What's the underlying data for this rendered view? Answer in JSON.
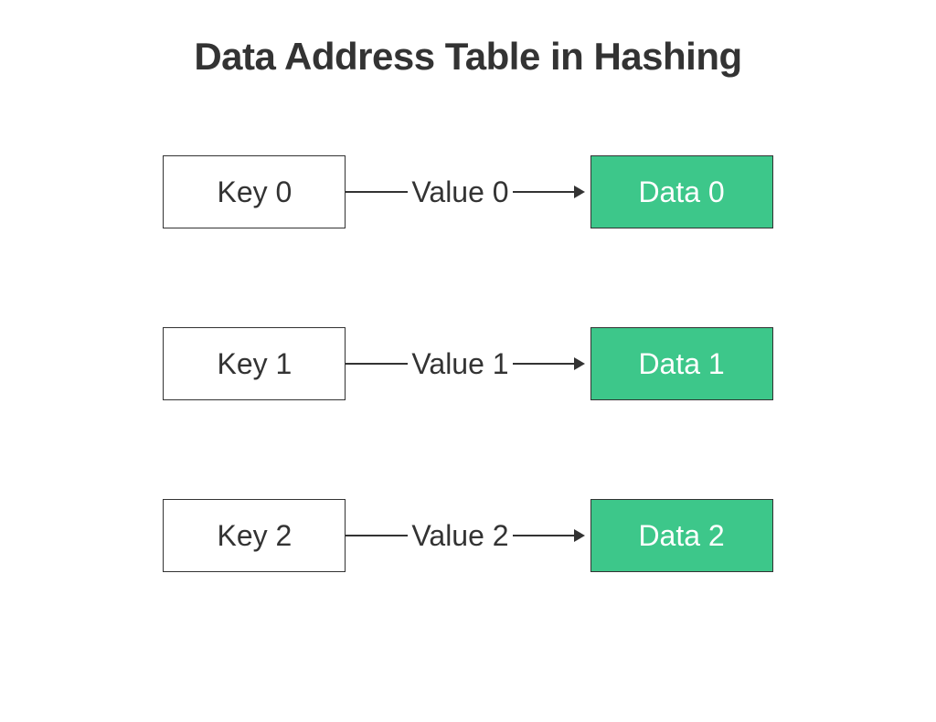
{
  "title": "Data Address Table in Hashing",
  "rows": [
    {
      "key": "Key 0",
      "value": "Value 0",
      "data": "Data 0"
    },
    {
      "key": "Key 1",
      "value": "Value 1",
      "data": "Data 1"
    },
    {
      "key": "Key 2",
      "value": "Value 2",
      "data": "Data 2"
    }
  ],
  "colors": {
    "data_box_bg": "#3DC78A",
    "data_box_text": "#ffffff",
    "border": "#333333",
    "text": "#333333"
  }
}
